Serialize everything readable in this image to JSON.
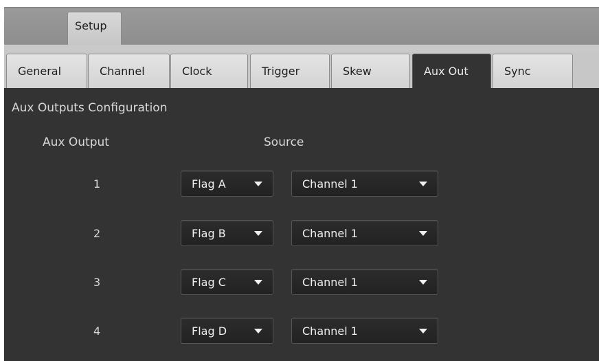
{
  "header": {
    "setup_tab": "Setup"
  },
  "tabs": [
    {
      "label": "General",
      "active": false
    },
    {
      "label": "Channel",
      "active": false
    },
    {
      "label": "Clock",
      "active": false
    },
    {
      "label": "Trigger",
      "active": false
    },
    {
      "label": "Skew",
      "active": false
    },
    {
      "label": "Aux Out",
      "active": true
    },
    {
      "label": "Sync",
      "active": false
    }
  ],
  "panel": {
    "title": "Aux Outputs Configuration",
    "col_aux_output": "Aux Output",
    "col_source": "Source"
  },
  "rows": [
    {
      "num": "1",
      "flag": "Flag A",
      "source": "Channel 1"
    },
    {
      "num": "2",
      "flag": "Flag B",
      "source": "Channel 1"
    },
    {
      "num": "3",
      "flag": "Flag C",
      "source": "Channel 1"
    },
    {
      "num": "4",
      "flag": "Flag D",
      "source": "Channel 1"
    }
  ],
  "icons": {
    "dropdown": "chevron-down-icon"
  },
  "colors": {
    "panel_bg": "#333333",
    "tab_bg": "#d3d3d3",
    "text_light": "#d8d8d8"
  }
}
